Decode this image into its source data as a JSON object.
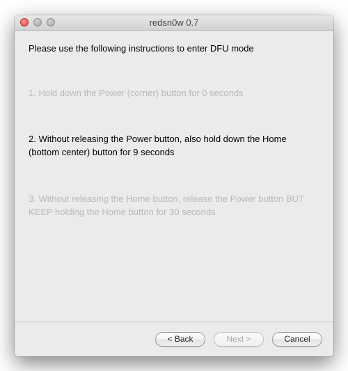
{
  "window": {
    "title": "redsn0w 0.7"
  },
  "content": {
    "heading": "Please use the following instructions to enter DFU mode",
    "steps": {
      "s1": "1. Hold down the Power (corner) button for 0 seconds",
      "s2": "2. Without releasing the Power button, also hold down the Home (bottom center) button for 9 seconds",
      "s3": "3. Without releasing the Home button, release the Power button BUT KEEP holding the Home button for 30 seconds"
    }
  },
  "footer": {
    "back_label": "< Back",
    "next_label": "Next >",
    "cancel_label": "Cancel"
  }
}
